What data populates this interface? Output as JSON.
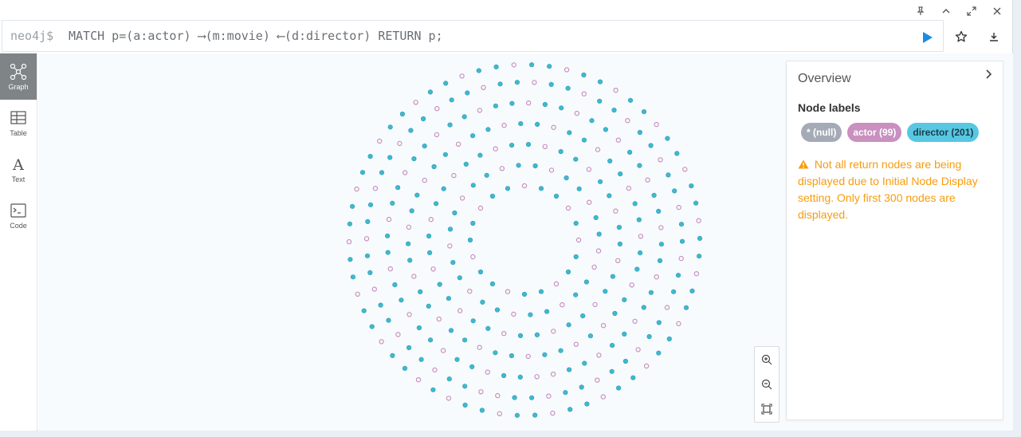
{
  "window": {
    "controls": [
      {
        "name": "pin",
        "glyph": "⌖"
      },
      {
        "name": "collapse",
        "glyph": "⌃"
      },
      {
        "name": "fullscreen",
        "glyph": "⤢"
      },
      {
        "name": "close",
        "glyph": "✕"
      }
    ]
  },
  "editor": {
    "prompt": "neo4j$",
    "query": "MATCH p=(a:actor) ⟶(m:movie) ⟵(d:director) RETURN p;"
  },
  "sidebar": {
    "items": [
      {
        "label": "Graph",
        "icon": "graph-icon",
        "active": true
      },
      {
        "label": "Table",
        "icon": "table-icon",
        "active": false
      },
      {
        "label": "Text",
        "icon": "text-icon",
        "active": false
      },
      {
        "label": "Code",
        "icon": "code-icon",
        "active": false
      }
    ]
  },
  "overview": {
    "title": "Overview",
    "section": "Node labels",
    "labels": [
      {
        "text": "* (null)",
        "color": "#a5abb6"
      },
      {
        "text": "actor (99)",
        "color": "#c990c0"
      },
      {
        "text": "director (201)",
        "color": "#57c7e3"
      }
    ],
    "warning": "Not all return nodes are being displayed due to Initial Node Display setting. Only first 300 nodes are displayed."
  },
  "graph": {
    "actor_color": "#c990c0",
    "director_color": "#3fb8d0",
    "total_nodes_shown": 300
  },
  "colors": {
    "run": "#1b8ce3",
    "warning": "#f79c0c",
    "active_tab": "#7f8487"
  }
}
